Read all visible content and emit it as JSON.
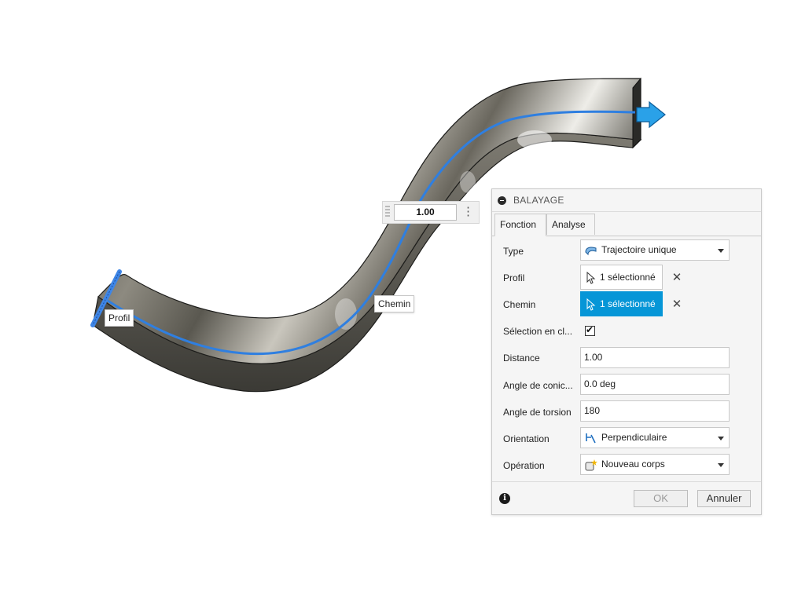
{
  "viewport": {
    "profile_tag": "Profil",
    "path_tag": "Chemin",
    "distance_value": "1.00",
    "distance_more": "⋮"
  },
  "panel": {
    "title": "BALAYAGE",
    "tabs": [
      "Fonction",
      "Analyse"
    ],
    "active_tab": "Fonction",
    "rows": {
      "type": {
        "label": "Type",
        "value": "Trajectoire unique",
        "icon": "single-path-sweep-icon"
      },
      "profil": {
        "label": "Profil",
        "value": "1 sélectionné",
        "icon": "cursor-select-icon",
        "clear": "✕"
      },
      "chemin": {
        "label": "Chemin",
        "value": "1 sélectionné",
        "icon": "cursor-select-icon",
        "clear": "✕"
      },
      "chain": {
        "label": "Sélection en cl...",
        "checked": true,
        "check": "✔"
      },
      "distance": {
        "label": "Distance",
        "value": "1.00"
      },
      "taper": {
        "label": "Angle de conic...",
        "value": "0.0 deg"
      },
      "twist": {
        "label": "Angle de torsion",
        "value": "180"
      },
      "orientation": {
        "label": "Orientation",
        "value": "Perpendiculaire",
        "icon": "perpendicular-icon"
      },
      "operation": {
        "label": "Opération",
        "value": "Nouveau corps",
        "icon": "new-body-icon"
      }
    },
    "footer": {
      "info": "i",
      "ok": "OK",
      "cancel": "Annuler"
    }
  },
  "colors": {
    "accent": "#0696d7",
    "path_line": "#2f7fe0",
    "body_dark": "#4a4a44",
    "body_light": "#d8d6ce"
  }
}
